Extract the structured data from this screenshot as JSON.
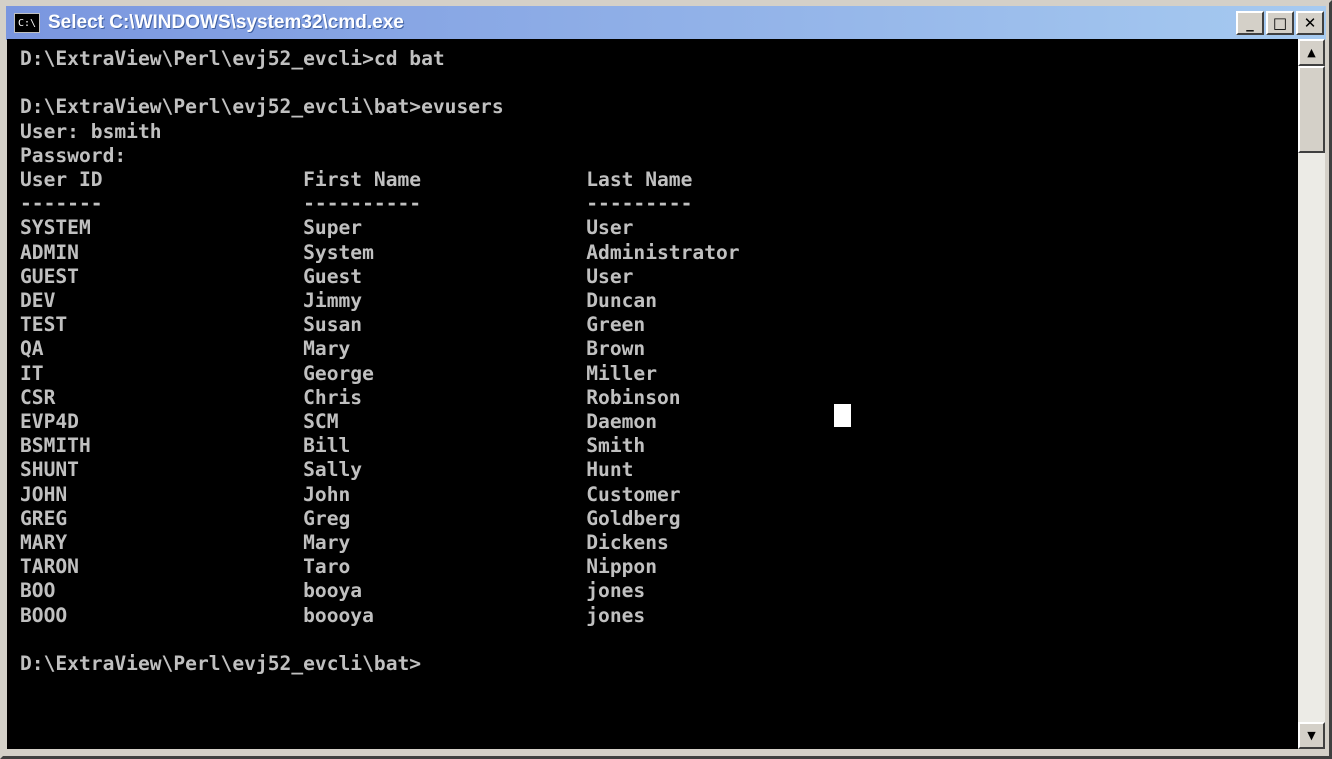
{
  "window": {
    "title": "Select C:\\WINDOWS\\system32\\cmd.exe",
    "icon_label": "C:\\",
    "minimize_label": "_",
    "maximize_label": "□",
    "close_label": "✕"
  },
  "console": {
    "lines": [
      "D:\\ExtraView\\Perl\\evj52_evcli>cd bat",
      "",
      "D:\\ExtraView\\Perl\\evj52_evcli\\bat>evusers",
      "User: bsmith",
      "Password:",
      "User ID                 First Name              Last Name",
      "-------                 ----------              ---------",
      "SYSTEM                  Super                   User",
      "ADMIN                   System                  Administrator",
      "GUEST                   Guest                   User",
      "DEV                     Jimmy                   Duncan",
      "TEST                    Susan                   Green",
      "QA                      Mary                    Brown",
      "IT                      George                  Miller",
      "CSR                     Chris                   Robinson",
      "EVP4D                   SCM                     Daemon",
      "BSMITH                  Bill                    Smith",
      "SHUNT                   Sally                   Hunt",
      "JOHN                    John                    Customer",
      "GREG                    Greg                    Goldberg",
      "MARY                    Mary                    Dickens",
      "TARON                   Taro                    Nippon",
      "BOO                     booya                   jones",
      "BOOO                    boooya                  jones",
      "",
      "D:\\ExtraView\\Perl\\evj52_evcli\\bat>"
    ]
  },
  "scrollbar": {
    "up_label": "▲",
    "down_label": "▼"
  },
  "colors": {
    "console_bg": "#000000",
    "console_text": "#c0c0c0",
    "titlebar_start": "#7a96df",
    "titlebar_end": "#a6caf0"
  }
}
